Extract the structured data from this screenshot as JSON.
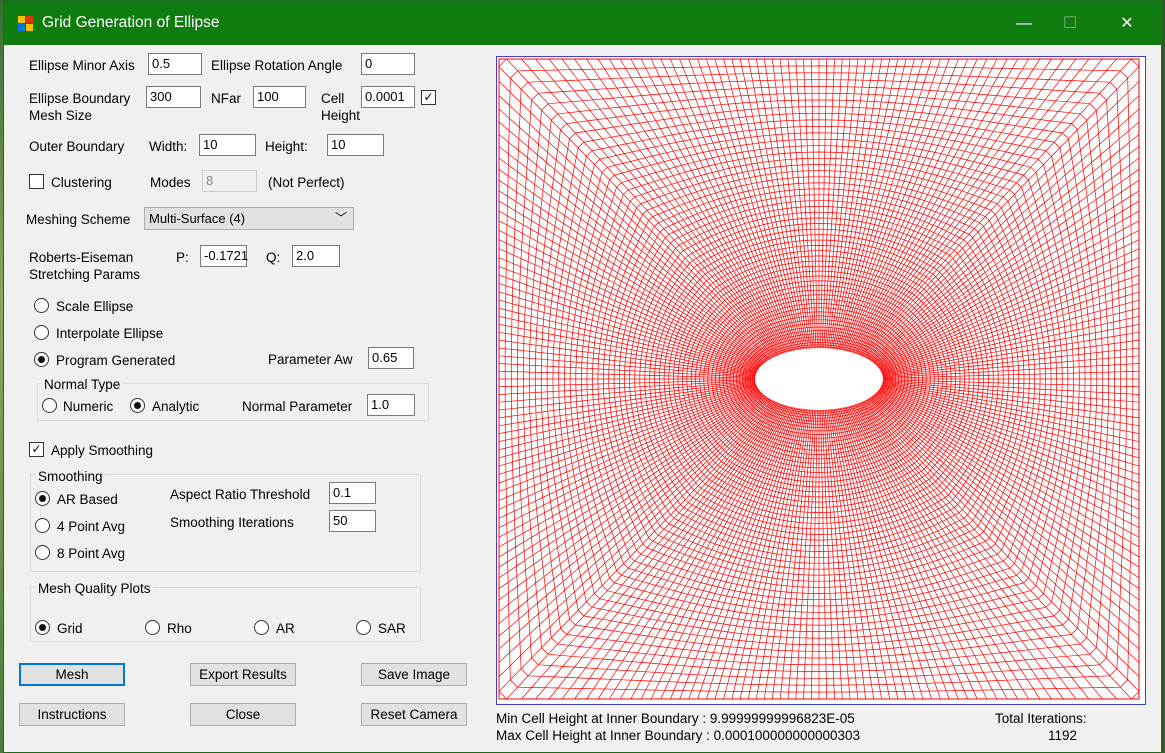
{
  "window": {
    "title": "Grid Generation of Ellipse",
    "minimize": "—",
    "maximize": "☐",
    "close": "✕"
  },
  "fields": {
    "minor_axis": {
      "label": "Ellipse Minor Axis",
      "value": "0.5"
    },
    "rotation": {
      "label": "Ellipse Rotation Angle",
      "value": "0"
    },
    "boundary_mesh": {
      "label_line1": "Ellipse Boundary",
      "label_line2": "Mesh Size",
      "value": "300"
    },
    "nfar": {
      "label": "NFar",
      "value": "100"
    },
    "cell_height": {
      "label_line1": "Cell",
      "label_line2": "Height",
      "value": "0.0001",
      "checked": true
    },
    "outer_boundary": {
      "label": "Outer Boundary",
      "width_label": "Width:",
      "width": "10",
      "height_label": "Height:",
      "height": "10"
    },
    "clustering": {
      "label": "Clustering",
      "checked": false,
      "modes_label": "Modes",
      "modes": "8",
      "note": "(Not Perfect)"
    },
    "meshing_scheme": {
      "label": "Meshing Scheme",
      "value": "Multi-Surface (4)"
    },
    "stretching": {
      "label_line1": "Roberts-Eiseman",
      "label_line2": "Stretching Params",
      "p_label": "P:",
      "p": "-0.1721",
      "q_label": "Q:",
      "q": "2.0"
    }
  },
  "ellipse_mode": {
    "options": [
      "Scale Ellipse",
      "Interpolate Ellipse",
      "Program Generated"
    ],
    "selected": "Program Generated",
    "param_aw_label": "Parameter Aw",
    "param_aw": "0.65"
  },
  "normal_type": {
    "title": "Normal Type",
    "options": [
      "Numeric",
      "Analytic"
    ],
    "selected": "Analytic",
    "param_label": "Normal Parameter",
    "param": "1.0"
  },
  "apply_smoothing": {
    "label": "Apply Smoothing",
    "checked": true
  },
  "smoothing": {
    "title": "Smoothing",
    "options": [
      "AR Based",
      "4 Point Avg",
      "8 Point Avg"
    ],
    "selected": "AR Based",
    "threshold_label": "Aspect Ratio Threshold",
    "threshold": "0.1",
    "iterations_label": "Smoothing Iterations",
    "iterations": "50"
  },
  "quality_plots": {
    "title": "Mesh Quality Plots",
    "options": [
      "Grid",
      "Rho",
      "AR",
      "SAR"
    ],
    "selected": "Grid"
  },
  "buttons": {
    "mesh": "Mesh",
    "export": "Export Results",
    "save_image": "Save Image",
    "instructions": "Instructions",
    "close": "Close",
    "reset_camera": "Reset Camera"
  },
  "status": {
    "min_label": "Min Cell Height  at Inner Boundary :",
    "min_value": "9.99999999996823E-05",
    "max_label": "Max Cell Height at Inner Boundary :",
    "max_value": "0.000100000000000303",
    "iterations_label": "Total Iterations:",
    "iterations_value": "1192"
  },
  "colors": {
    "title_bar": "#107c10",
    "grid_line": "#ff0000",
    "plot_border": "#4040c0",
    "accent": "#0078d7"
  }
}
